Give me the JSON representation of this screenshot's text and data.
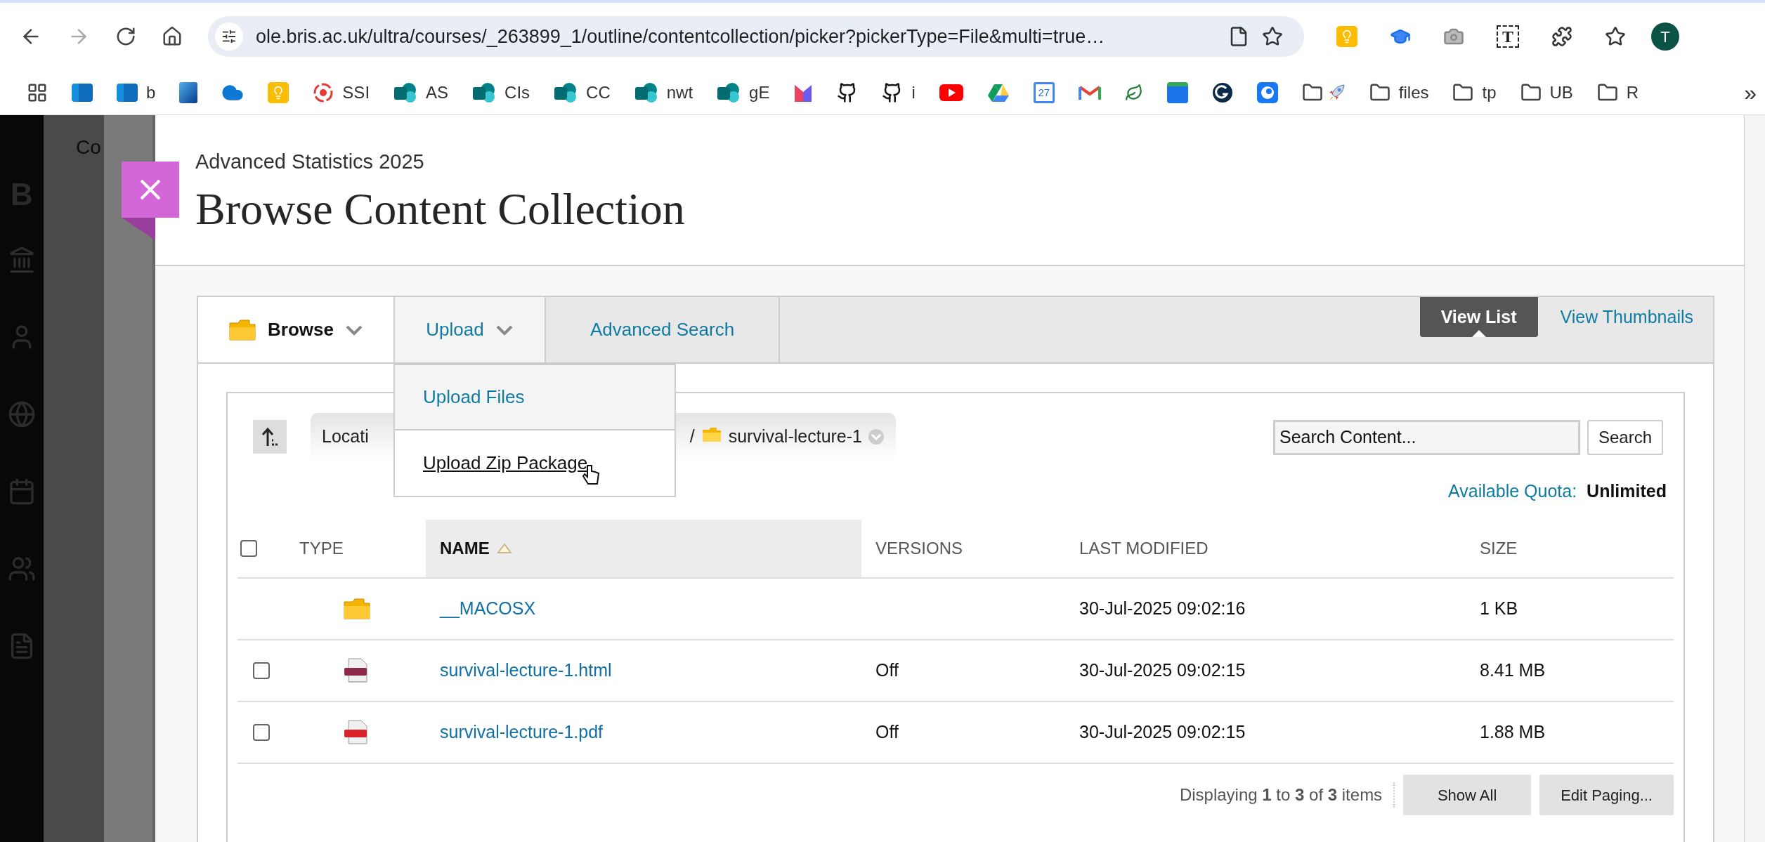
{
  "browser": {
    "url": "ole.bris.ac.uk/ultra/courses/_263899_1/outline/contentcollection/picker?pickerType=File&multi=true…",
    "extensions": [
      {
        "kind": "bulb"
      },
      {
        "kind": "mortarboard"
      },
      {
        "kind": "camera"
      },
      {
        "kind": "text",
        "label": "T"
      },
      {
        "kind": "puzzle"
      },
      {
        "kind": "starlist"
      }
    ],
    "avatar": "T"
  },
  "bookmarks": [
    {
      "kind": "apps"
    },
    {
      "kind": "mail"
    },
    {
      "kind": "mail",
      "label": "b"
    },
    {
      "kind": "tiles"
    },
    {
      "kind": "cloud"
    },
    {
      "kind": "bulb"
    },
    {
      "kind": "target",
      "label": "SSI"
    },
    {
      "kind": "sharepoint",
      "label": "AS"
    },
    {
      "kind": "sharepoint",
      "label": "CIs"
    },
    {
      "kind": "sharepoint",
      "label": "CC"
    },
    {
      "kind": "sharepoint",
      "label": "nwt"
    },
    {
      "kind": "sharepoint",
      "label": "gE"
    },
    {
      "kind": "bars"
    },
    {
      "kind": "cat"
    },
    {
      "kind": "cat",
      "label": "i"
    },
    {
      "kind": "play"
    },
    {
      "kind": "drive"
    },
    {
      "kind": "calendar",
      "label": "27"
    },
    {
      "kind": "envelope"
    },
    {
      "kind": "leaf"
    },
    {
      "kind": "news"
    },
    {
      "kind": "gcircle"
    },
    {
      "kind": "eye"
    },
    {
      "kind": "rocketfolder"
    },
    {
      "kind": "folder",
      "label": "files"
    },
    {
      "kind": "folder",
      "label": "tp"
    },
    {
      "kind": "folder",
      "label": "UB"
    },
    {
      "kind": "folder",
      "label": "R"
    },
    {
      "kind": "more",
      "label": "»"
    }
  ],
  "background": {
    "tab_text": "Co",
    "logo_text": "B"
  },
  "dialog": {
    "course": "Advanced Statistics 2025",
    "title": "Browse Content Collection",
    "menus": [
      {
        "label": "Browse",
        "kind": "browse",
        "selected": true,
        "expanded": false
      },
      {
        "label": "Upload",
        "kind": "dropdown",
        "selected": false,
        "expanded": true
      },
      {
        "label": "Advanced Search",
        "kind": "link",
        "selected": false,
        "expanded": false
      }
    ],
    "views": [
      {
        "label": "View List",
        "selected": true
      },
      {
        "label": "View Thumbnails",
        "selected": false
      }
    ],
    "dropdown": [
      {
        "label": "Upload Files",
        "hovered": false
      },
      {
        "label": "Upload Zip Package",
        "hovered": true
      }
    ],
    "location": {
      "label": "Locati",
      "separator": "/",
      "folder": "survival-lecture-1"
    },
    "search": {
      "value": "Search Content...",
      "button": "Search"
    },
    "quota": {
      "label": "Available Quota:",
      "value": "Unlimited"
    },
    "table": {
      "select_all_checked": false,
      "columns": [
        {
          "label": "TYPE",
          "sorted": false
        },
        {
          "label": "NAME",
          "sorted": true
        },
        {
          "label": "VERSIONS",
          "sorted": false
        },
        {
          "label": "LAST MODIFIED",
          "sorted": false
        },
        {
          "label": "SIZE",
          "sorted": false
        }
      ],
      "rows": [
        {
          "kind": "folder",
          "name": "__MACOSX",
          "modified": "30-Jul-2025 09:02:16",
          "size": "1 KB"
        },
        {
          "checked": false,
          "kind": "html",
          "name": "survival-lecture-1.html",
          "versions": "Off",
          "modified": "30-Jul-2025 09:02:15",
          "size": "8.41 MB"
        },
        {
          "checked": false,
          "kind": "pdf",
          "name": "survival-lecture-1.pdf",
          "versions": "Off",
          "modified": "30-Jul-2025 09:02:15",
          "size": "1.88 MB"
        }
      ]
    },
    "footer": {
      "summary": "Displaying **1** to **3** of **3** items",
      "buttons": [
        "Show All",
        "Edit Paging..."
      ]
    }
  }
}
